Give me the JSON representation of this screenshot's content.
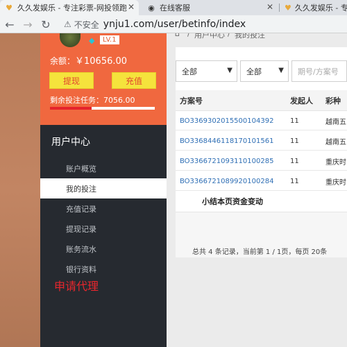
{
  "browser": {
    "tabs": [
      {
        "title": "久久发娱乐 - 专注彩票-网投领跑",
        "favicon": "heart-icon"
      },
      {
        "title": "在线客服",
        "favicon": "chat-icon"
      },
      {
        "title": "久久发娱乐 - 专注",
        "favicon": "heart-icon"
      }
    ],
    "security_label": "不安全",
    "url": "ynju1.com/user/betinfo/index"
  },
  "user": {
    "level": "LV.1",
    "balance_label": "余额：",
    "balance_value": "￥10656.00",
    "withdraw_label": "提现",
    "deposit_label": "充值",
    "remain_label": "剩余投注任务：",
    "remain_value": "7056.00",
    "remain_progress": 0.4
  },
  "menu": {
    "title": "用户中心",
    "items": [
      {
        "label": "账户概览"
      },
      {
        "label": "我的投注"
      },
      {
        "label": "充值记录"
      },
      {
        "label": "提现记录"
      },
      {
        "label": "账务流水"
      },
      {
        "label": "银行资料"
      }
    ],
    "active_index": 1,
    "agent_label": "申请代理"
  },
  "breadcrumb": {
    "parent": "用户中心",
    "current": "我的投注"
  },
  "filters": {
    "select1": "全部",
    "select2": "全部",
    "search_placeholder": "期号/方案号"
  },
  "table": {
    "columns": [
      "方案号",
      "发起人",
      "彩种"
    ],
    "rows": [
      {
        "id": "BO33693020155001043​92",
        "initiator": "11",
        "lottery": "越南五"
      },
      {
        "id": "BO33684461181701015​61",
        "initiator": "11",
        "lottery": "越南五"
      },
      {
        "id": "BO33667210931101002​85",
        "initiator": "11",
        "lottery": "重庆时"
      },
      {
        "id": "BO33667210899201002​84",
        "initiator": "11",
        "lottery": "重庆时"
      }
    ]
  },
  "summary_label": "小结本页资金变动",
  "pager_text": "总共 4 条记录，当前第 1 / 1页，每页 20条",
  "colors": {
    "accent": "#f0683f",
    "sidebar_bg": "#262a30",
    "button_yellow": "#f5e33c",
    "link_blue": "#2f6fb5",
    "agent_red": "#e8262d"
  }
}
